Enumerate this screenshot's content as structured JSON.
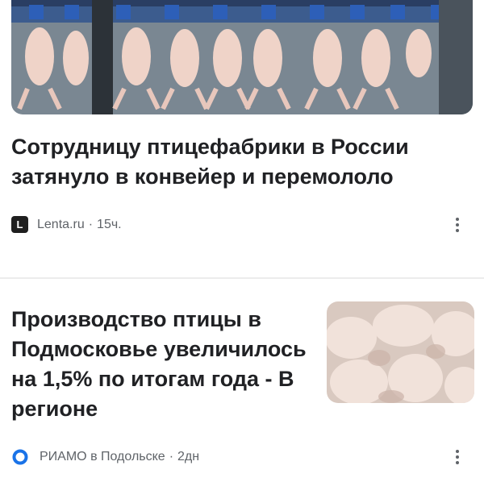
{
  "articles": [
    {
      "headline": "Сотрудницу птицефабрики в России затянуло в конвейер и перемололо",
      "image": "poultry-conveyor-photo",
      "source": "Lenta.ru",
      "source_logo_letter": "L",
      "separator": "·",
      "time": "15ч."
    },
    {
      "headline": "Производство птицы в Подмосковье увеличилось на 1,5% по итогам года - В регионе",
      "image": "raw-chicken-photo",
      "source": "РИАМО в Подольске",
      "separator": "·",
      "time": "2дн"
    }
  ],
  "icons": {
    "more": "more-vert-icon",
    "riamo_logo": "riamo-logo-icon"
  },
  "colors": {
    "text": "#202124",
    "meta": "#5f6368",
    "riamo_blue": "#1a73e8"
  }
}
